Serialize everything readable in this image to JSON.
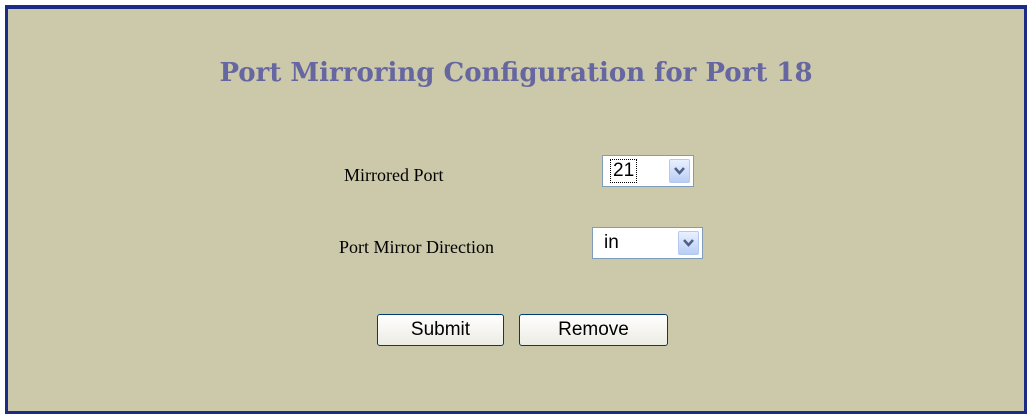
{
  "title": "Port Mirroring Configuration for Port 18",
  "form": {
    "mirrored_port_label": "Mirrored Port",
    "mirrored_port_value": "21",
    "direction_label": "Port Mirror Direction",
    "direction_value": "in"
  },
  "buttons": {
    "submit": "Submit",
    "remove": "Remove"
  },
  "colors": {
    "background": "#ccc9aa",
    "border": "#1c2c85",
    "title": "#6666a0"
  },
  "icons": {
    "dropdown": "chevron-down-icon"
  }
}
